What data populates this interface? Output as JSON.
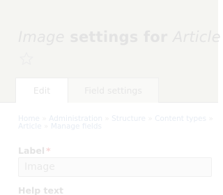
{
  "header": {
    "title_part1": "Image",
    "title_part2": " settings for ",
    "title_part3": "Article",
    "star_icon": "star-outline-icon"
  },
  "tabs": [
    {
      "label": "Edit",
      "active": true
    },
    {
      "label": "Field settings",
      "active": false
    }
  ],
  "breadcrumb": {
    "items": [
      "Home",
      "Administration",
      "Structure",
      "Content types",
      "Article",
      "Manage fields"
    ],
    "separator": "»"
  },
  "form": {
    "label_field": {
      "label": "Label",
      "required_marker": "*",
      "value": "Image"
    },
    "help_text": {
      "label": "Help text"
    }
  },
  "colors": {
    "header_bg": "#f5f5f2",
    "text_faded": "#e3e3e3",
    "link_faded": "#e7ecf3",
    "required": "#f7d7d7"
  }
}
